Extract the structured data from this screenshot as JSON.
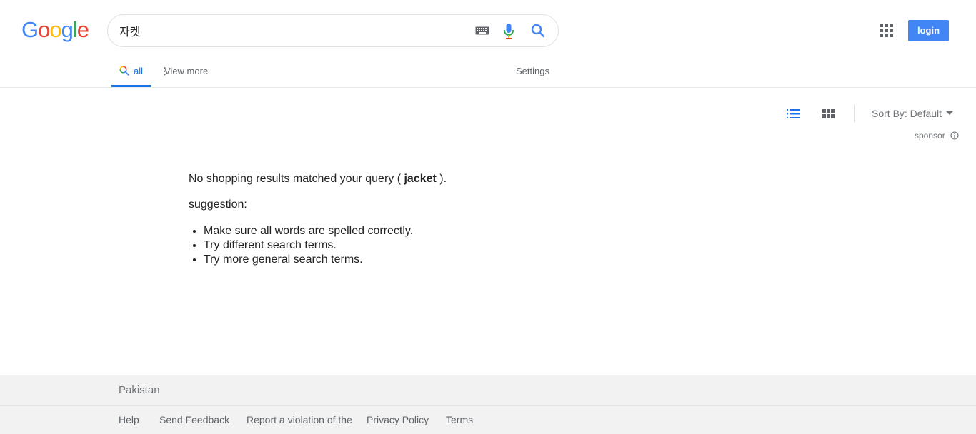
{
  "logo": [
    "G",
    "o",
    "o",
    "g",
    "l",
    "e"
  ],
  "logo_colors": [
    "#4285f4",
    "#ea4335",
    "#fbbc05",
    "#4285f4",
    "#34a853",
    "#ea4335"
  ],
  "search": {
    "value": "자켓"
  },
  "icons": {
    "keyboard": "keyboard-icon",
    "mic": "mic-icon",
    "search": "search-icon",
    "apps": "apps-icon"
  },
  "header": {
    "login_label": "login"
  },
  "tabs": {
    "all": "all",
    "more": "View more",
    "settings": "Settings"
  },
  "results_bar": {
    "sort_label": "Sort By: Default",
    "sponsor": "sponsor"
  },
  "main": {
    "msg_prefix": "No shopping results matched your query ( ",
    "query": "jacket",
    "msg_suffix": " ).",
    "suggestion_label": "suggestion:",
    "tips": [
      "Make sure all words are spelled correctly.",
      "Try different search terms.",
      "Try more general search terms."
    ]
  },
  "footer": {
    "country": "Pakistan",
    "links": [
      "Help",
      "Send Feedback",
      "Report a violation of the",
      "Privacy Policy",
      "Terms"
    ]
  },
  "colors": {
    "accent": "#1a73e8",
    "login_bg": "#4285f4"
  }
}
